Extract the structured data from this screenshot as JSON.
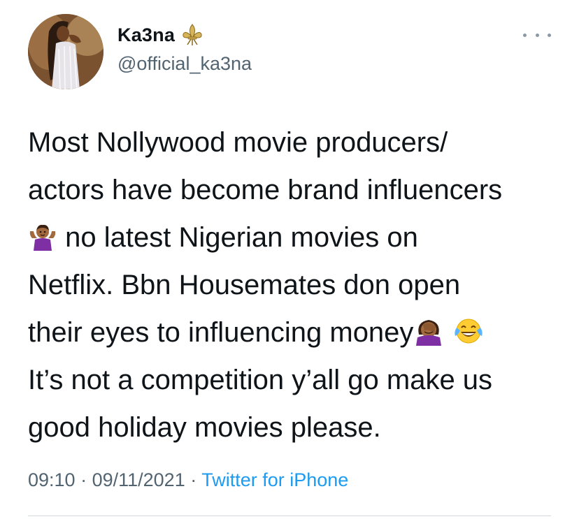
{
  "tweet": {
    "author": {
      "display_name": "Ka3na",
      "handle": "@official_ka3na",
      "badge_icon": "fleur-de-lis-icon",
      "avatar_icon": "profile-photo"
    },
    "more_icon": "more-options-icon",
    "text_lines": {
      "line1": "Most Nollywood movie producers/",
      "line2": "actors have become brand influencers",
      "line3": " no latest Nigerian movies on",
      "line4": "Netflix. Bbn Housemates don open",
      "line5": "their eyes to influencing money",
      "line6": "It’s not a competition y’all go make us",
      "line7": "good holiday movies please."
    },
    "emojis": {
      "shrug": "person-shrugging-emoji",
      "facepalm": "person-facepalming-emoji",
      "tears_of_joy": "face-with-tears-of-joy-emoji"
    },
    "meta": {
      "time": "09:10",
      "separator1": " · ",
      "date": "09/11/2021",
      "separator2": " · ",
      "source": "Twitter for iPhone"
    },
    "colors": {
      "text": "#0f1419",
      "secondary": "#536471",
      "link": "#1d9bf0",
      "badge": "#c8a44a",
      "divider": "#cfd9de"
    }
  }
}
